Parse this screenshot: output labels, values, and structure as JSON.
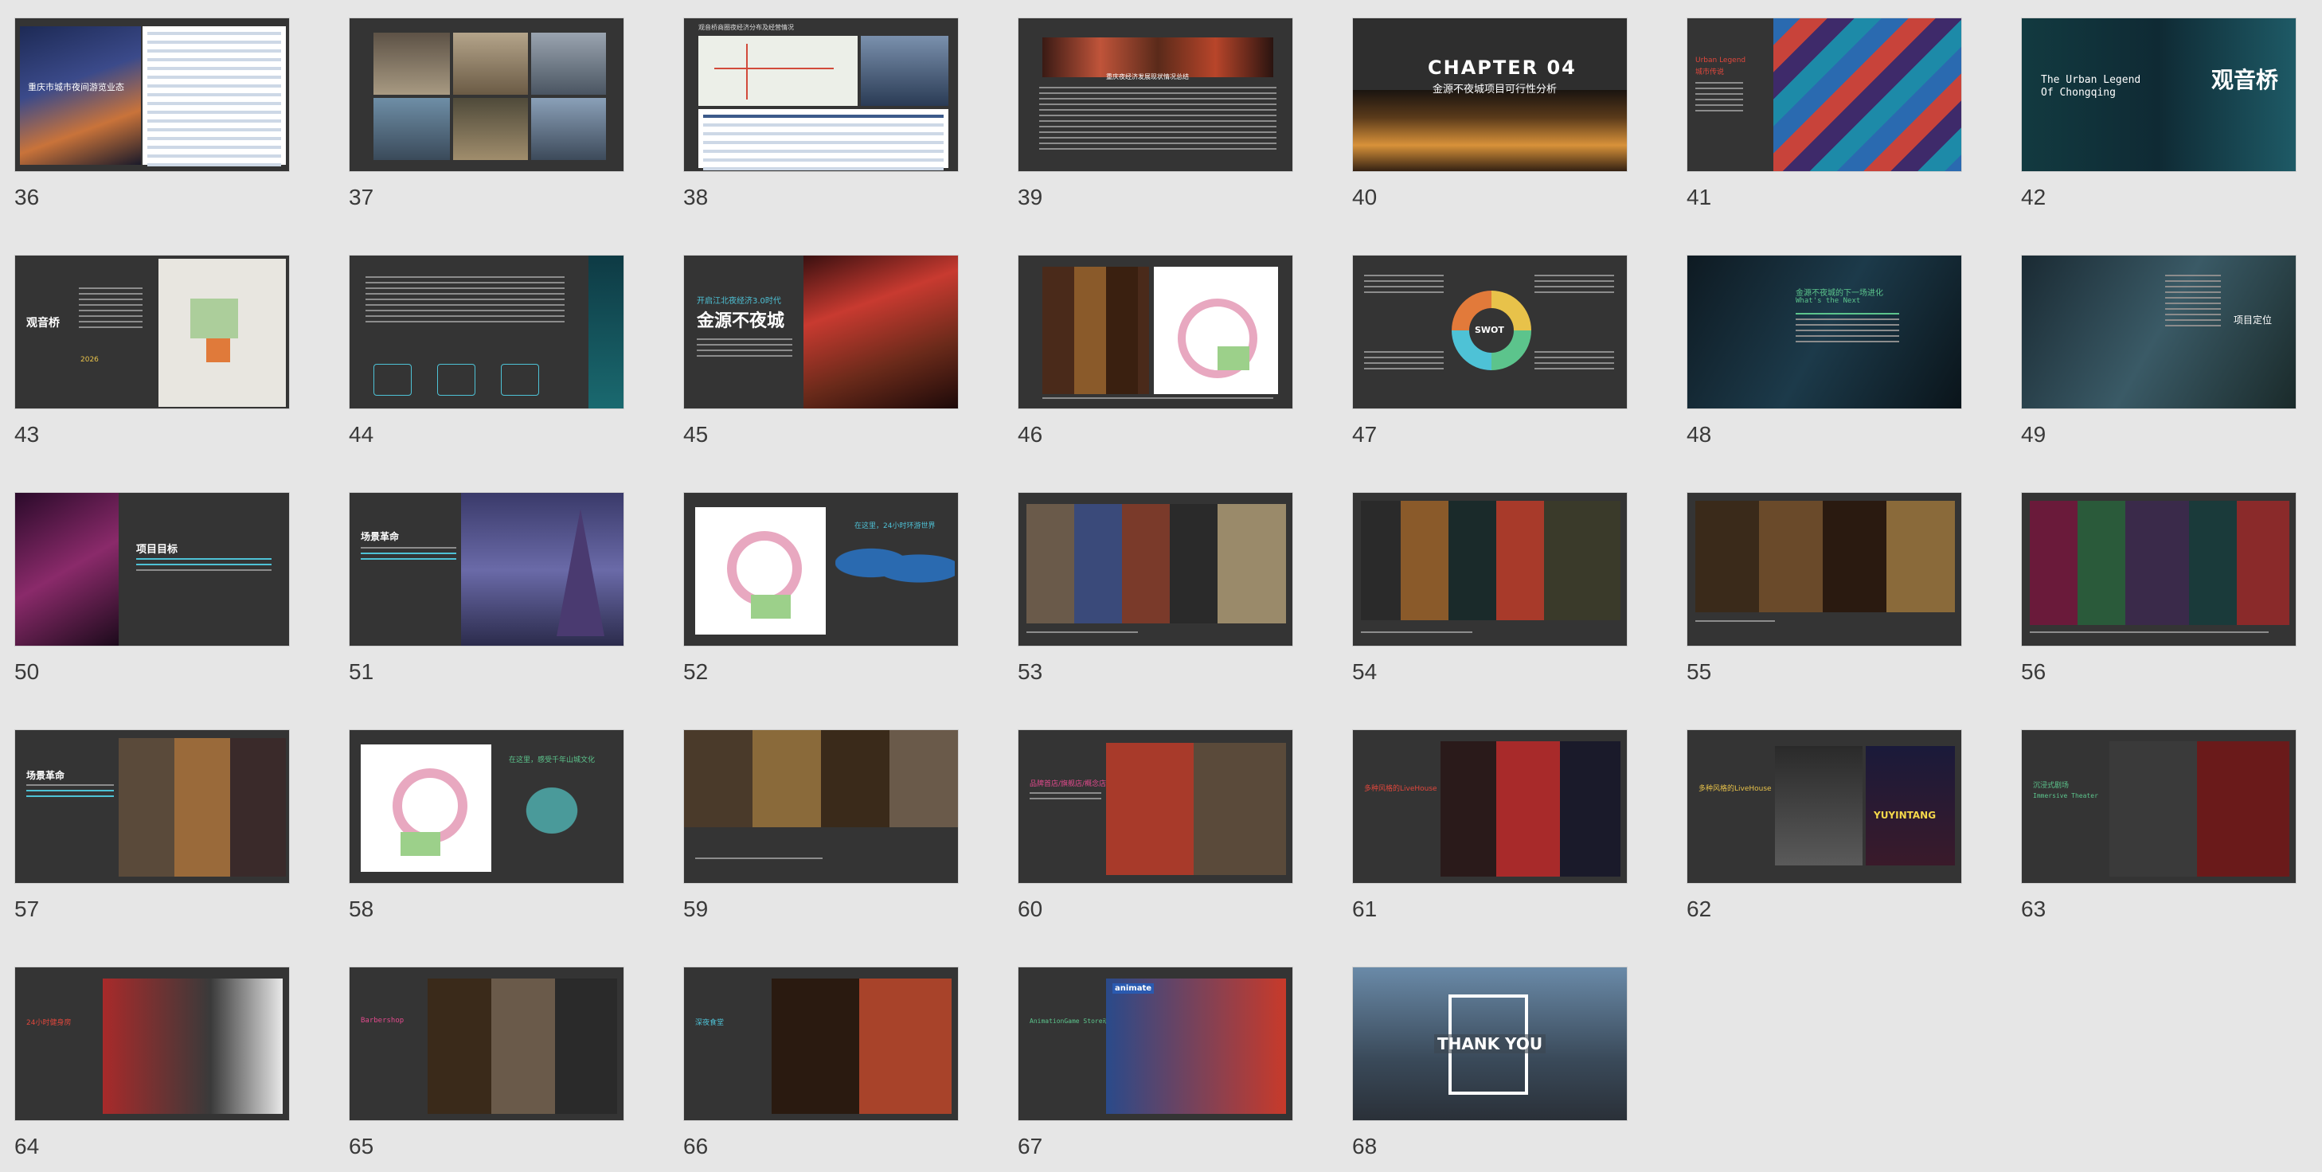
{
  "slides": [
    {
      "num": "36",
      "title": "重庆市城市夜间游览业态",
      "subtitle": ""
    },
    {
      "num": "37",
      "title": "",
      "subtitle": ""
    },
    {
      "num": "38",
      "title": "观音桥商圈夜经济分布及经营情况",
      "subtitle": ""
    },
    {
      "num": "39",
      "title": "重庆夜经济发展现状情况总结",
      "subtitle": ""
    },
    {
      "num": "40",
      "title": "CHAPTER 04",
      "subtitle": "金源不夜城项目可行性分析"
    },
    {
      "num": "41",
      "title": "Urban Legend",
      "subtitle": "城市传说"
    },
    {
      "num": "42",
      "title": "The Urban Legend",
      "subtitle": "Of Chongqing",
      "extra": "观音桥"
    },
    {
      "num": "43",
      "title": "观音桥",
      "subtitle": "2026"
    },
    {
      "num": "44",
      "title": "",
      "subtitle": ""
    },
    {
      "num": "45",
      "title": "开启江北夜经济3.0时代",
      "subtitle": "金源不夜城"
    },
    {
      "num": "46",
      "title": "",
      "subtitle": ""
    },
    {
      "num": "47",
      "title": "SWOT",
      "subtitle": ""
    },
    {
      "num": "48",
      "title": "金源不夜城的下一场进化",
      "subtitle": "What's the Next"
    },
    {
      "num": "49",
      "title": "项目定位",
      "subtitle": ""
    },
    {
      "num": "50",
      "title": "项目目标",
      "subtitle": ""
    },
    {
      "num": "51",
      "title": "场景革命",
      "subtitle": ""
    },
    {
      "num": "52",
      "title": "在这里，24小时环游世界",
      "subtitle": ""
    },
    {
      "num": "53",
      "title": "",
      "subtitle": ""
    },
    {
      "num": "54",
      "title": "",
      "subtitle": ""
    },
    {
      "num": "55",
      "title": "",
      "subtitle": ""
    },
    {
      "num": "56",
      "title": "",
      "subtitle": ""
    },
    {
      "num": "57",
      "title": "场景革命",
      "subtitle": ""
    },
    {
      "num": "58",
      "title": "在这里，感受千年山城文化",
      "subtitle": ""
    },
    {
      "num": "59",
      "title": "",
      "subtitle": ""
    },
    {
      "num": "60",
      "title": "品牌首店/旗舰店/概念店",
      "subtitle": ""
    },
    {
      "num": "61",
      "title": "多种风格的LiveHouse",
      "subtitle": ""
    },
    {
      "num": "62",
      "title": "多种风格的LiveHouse",
      "subtitle": "YUYINTANG"
    },
    {
      "num": "63",
      "title": "沉浸式剧场",
      "subtitle": "Immersive Theater"
    },
    {
      "num": "64",
      "title": "24小时健身房",
      "subtitle": ""
    },
    {
      "num": "65",
      "title": "Barbershop",
      "subtitle": ""
    },
    {
      "num": "66",
      "title": "深夜食堂",
      "subtitle": ""
    },
    {
      "num": "67",
      "title": "AnimationGame Store动画游戏商店",
      "subtitle": "animate"
    },
    {
      "num": "68",
      "title": "THANK YOU",
      "subtitle": ""
    }
  ],
  "colors": {
    "background": "#e6e6e6",
    "slide_bg": "#343434",
    "accent_blue": "#4ec2d6",
    "accent_red": "#e0473c",
    "accent_green": "#5cc48c",
    "accent_yellow": "#e8c24a",
    "accent_pink": "#e24a8d"
  }
}
